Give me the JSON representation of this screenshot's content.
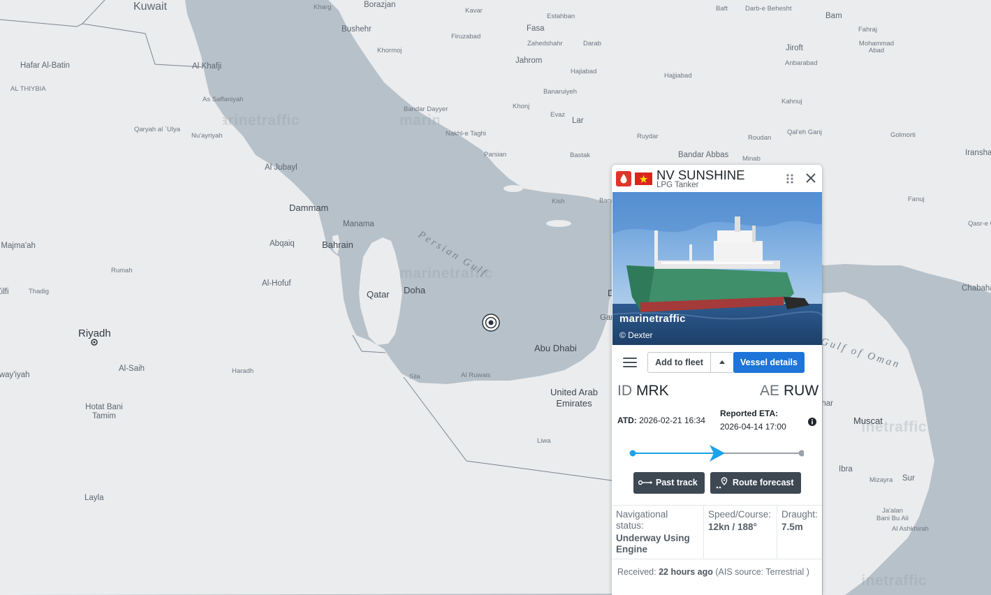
{
  "map": {
    "places": [
      {
        "name": "Kuwait",
        "size": "l"
      },
      {
        "name": "Kharg",
        "size": "s"
      },
      {
        "name": "Borazjan",
        "size": "m"
      },
      {
        "name": "Kavar",
        "size": "s"
      },
      {
        "name": "Estahban",
        "size": "s"
      },
      {
        "name": "Baft",
        "size": "s"
      },
      {
        "name": "Darb-e Behesht",
        "size": "s"
      },
      {
        "name": "Bam",
        "size": "m"
      },
      {
        "name": "Fahraj",
        "size": "s"
      },
      {
        "name": "Mohammad Abad",
        "size": "s"
      },
      {
        "name": "Bushehr",
        "size": "m"
      },
      {
        "name": "Firuzabad",
        "size": "s"
      },
      {
        "name": "Fasa",
        "size": "m"
      },
      {
        "name": "Zahedshahr",
        "size": "s"
      },
      {
        "name": "Darab",
        "size": "s"
      },
      {
        "name": "Jiroft",
        "size": "m"
      },
      {
        "name": "Anbarabad",
        "size": "s"
      },
      {
        "name": "Khormoj",
        "size": "s"
      },
      {
        "name": "Jahrom",
        "size": "m"
      },
      {
        "name": "Hajiabad",
        "size": "s"
      },
      {
        "name": "Hajjiabad",
        "size": "s"
      },
      {
        "name": "Hafar Al-Batin",
        "size": "m"
      },
      {
        "name": "Al Khafji",
        "size": "m"
      },
      {
        "name": "AL THIYBIA",
        "size": "s"
      },
      {
        "name": "Banaruiyeh",
        "size": "s"
      },
      {
        "name": "Kahnuj",
        "size": "s"
      },
      {
        "name": "As Saffaniyah",
        "size": "s"
      },
      {
        "name": "Khonj",
        "size": "s"
      },
      {
        "name": "Bandar Dayyer",
        "size": "s"
      },
      {
        "name": "Evaz",
        "size": "s"
      },
      {
        "name": "Lar",
        "size": "m"
      },
      {
        "name": "Qaryah al `Ulya",
        "size": "s"
      },
      {
        "name": "Nu'ayriyah",
        "size": "s"
      },
      {
        "name": "Nakhl-e Taghi",
        "size": "s"
      },
      {
        "name": "Ruydar",
        "size": "s"
      },
      {
        "name": "Roudan",
        "size": "s"
      },
      {
        "name": "Qal'eh Ganj",
        "size": "s"
      },
      {
        "name": "Golmorti",
        "size": "s"
      },
      {
        "name": "Parsian",
        "size": "s"
      },
      {
        "name": "Bastak",
        "size": "s"
      },
      {
        "name": "Bandar Abbas",
        "size": "m"
      },
      {
        "name": "Minab",
        "size": "s"
      },
      {
        "name": "Iranshahr",
        "size": "m"
      },
      {
        "name": "Al Jubayl",
        "size": "m"
      },
      {
        "name": "Kish",
        "size": "s"
      },
      {
        "name": "Bandar Lengeh",
        "size": "s"
      },
      {
        "name": "Fanuj",
        "size": "s"
      },
      {
        "name": "Dammam",
        "size": "l"
      },
      {
        "name": "Manama",
        "size": "m"
      },
      {
        "name": "Qasr-e Qand",
        "size": "s"
      },
      {
        "name": "Abqaiq",
        "size": "m"
      },
      {
        "name": "Bahrain",
        "size": "l"
      },
      {
        "name": "Al Majma'ah",
        "size": "m"
      },
      {
        "name": "Rumah",
        "size": "s"
      },
      {
        "name": "Al-Hofuf",
        "size": "m"
      },
      {
        "name": "Doha",
        "size": "l"
      },
      {
        "name": "Qatar",
        "size": "l"
      },
      {
        "name": "Az Zilfi",
        "size": "s"
      },
      {
        "name": "Thadig",
        "size": "s"
      },
      {
        "name": "Chabahar",
        "size": "m"
      },
      {
        "name": "Riyadh",
        "size": "xl"
      },
      {
        "name": "Dubai",
        "size": "l"
      },
      {
        "name": "Garmi",
        "size": "m"
      },
      {
        "name": "Abu Dhabi",
        "size": "l"
      },
      {
        "name": "Al-Saih",
        "size": "m"
      },
      {
        "name": "Haradh",
        "size": "s"
      },
      {
        "name": "Al Quway'iyah",
        "size": "m"
      },
      {
        "name": "Sila",
        "size": "s"
      },
      {
        "name": "Al Ruwais",
        "size": "s"
      },
      {
        "name": "United Arab Emirates",
        "size": "l"
      },
      {
        "name": "Sohar",
        "size": "m"
      },
      {
        "name": "Muscat",
        "size": "l"
      },
      {
        "name": "Hotat Bani Tamim",
        "size": "m"
      },
      {
        "name": "Liwa",
        "size": "s"
      },
      {
        "name": "Ibra",
        "size": "m"
      },
      {
        "name": "Sur",
        "size": "m"
      },
      {
        "name": "Mizayra",
        "size": "s"
      },
      {
        "name": "Ja'alan Bani Bu Ali",
        "size": "s"
      },
      {
        "name": "Al Ashkhirah",
        "size": "s"
      },
      {
        "name": "Layla",
        "size": "m"
      }
    ],
    "seas": [
      "Persian Gulf",
      "Gulf of Oman"
    ],
    "watermark": "marinetraffic"
  },
  "vessel": {
    "name": "NV SUNSHINE",
    "type": "LPG Tanker",
    "photo_watermark": "marinetraffic",
    "photo_credit": "© Dexter",
    "buttons": {
      "add_to_fleet": "Add to fleet",
      "vessel_details": "Vessel details",
      "past_track": "Past track",
      "route_forecast": "Route forecast"
    },
    "departure": {
      "country": "ID",
      "port": "MRK"
    },
    "arrival": {
      "country": "AE",
      "port": "RUW"
    },
    "atd_label": "ATD:",
    "atd_value": "2026-02-21 16:34",
    "eta_label": "Reported ETA:",
    "eta_value": "2026-04-14 17:00",
    "route_progress": 0.5,
    "nav_status_label": "Navigational status:",
    "nav_status_value": "Underway Using Engine",
    "speed_course_label": "Speed/Course:",
    "speed_course_value": "12kn / 188°",
    "draught_label": "Draught:",
    "draught_value": "7.5m",
    "received_label": "Received:",
    "received_value": "22 hours ago",
    "ais_source": "(AIS source: Terrestrial )",
    "colors": {
      "accent": "#1e74d8",
      "route": "#1aa3e8",
      "tanker_badge": "#e0352b",
      "dark_button": "#3d4853"
    }
  }
}
